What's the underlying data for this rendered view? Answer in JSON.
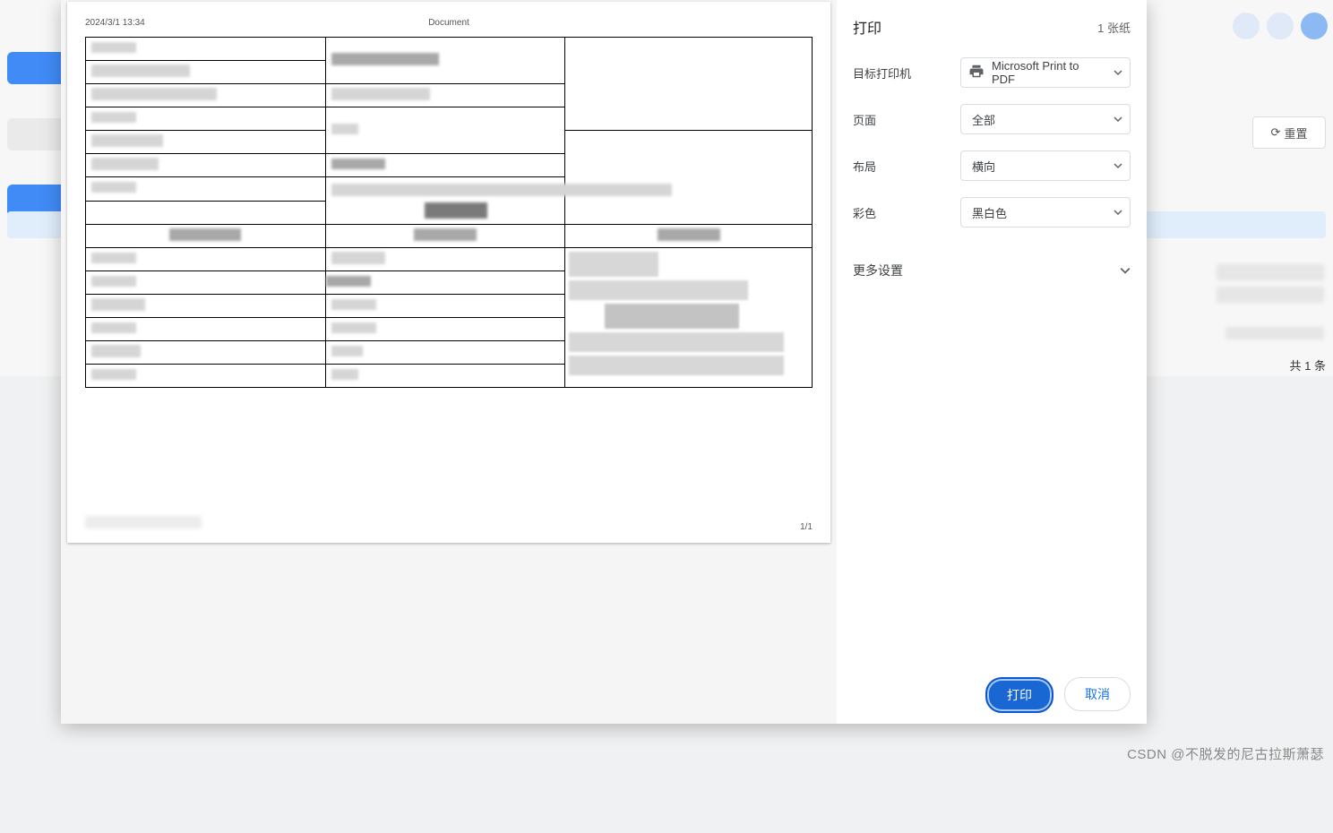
{
  "bg": {
    "reset_label": "重置",
    "pagination": "共 1 条"
  },
  "preview": {
    "timestamp": "2024/3/1 13:34",
    "doc_title": "Document",
    "page_indicator": "1/1"
  },
  "settings": {
    "title": "打印",
    "sheets_count": "1 张纸",
    "destination": {
      "label": "目标打印机",
      "value": "Microsoft Print to PDF"
    },
    "pages": {
      "label": "页面",
      "value": "全部"
    },
    "layout": {
      "label": "布局",
      "value": "横向"
    },
    "color": {
      "label": "彩色",
      "value": "黑白色"
    },
    "more_label": "更多设置"
  },
  "buttons": {
    "print": "打印",
    "cancel": "取消"
  },
  "watermark": "CSDN @不脱发的尼古拉斯萧瑟"
}
